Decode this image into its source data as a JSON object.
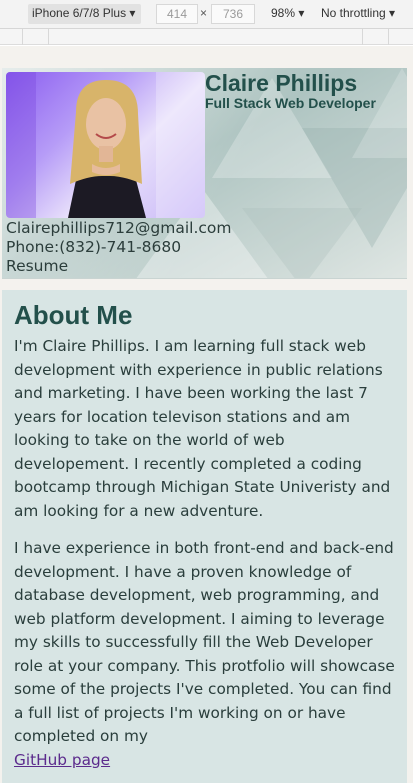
{
  "devtools": {
    "device": "iPhone 6/7/8 Plus ▾",
    "width": "414",
    "times": "×",
    "height": "736",
    "zoom": "98% ▾",
    "throttling": "No throttling ▾"
  },
  "header": {
    "name": "Claire Phillips",
    "role": "Full Stack Web Developer",
    "email": "Clairephillips712@gmail.com",
    "phone": "Phone:(832)-741-8680",
    "resume": "Resume"
  },
  "about": {
    "title": "About Me",
    "paragraph1": "I'm Claire Phillips. I am learning full stack web development with experience in public relations and marketing. I have been working the last 7 years for location televison stations and am looking to take on the world of web developement. I recently completed a coding bootcamp through Michigan State Univeristy and am looking for a new adventure.",
    "paragraph2": "I have experience in both front-end and back-end development. I have a proven knowledge of database development, web programming, and web platform development. I aiming to leverage my skills to successfully fill the Web Developer role at your company. This protfolio will showcase some of the projects I've completed. You can find a full list of projects I'm working on or have completed on my",
    "link": "GitHub page"
  },
  "colors": {
    "accent": "#23504b",
    "link": "#5b2a8c",
    "panel": "#d8e5e4"
  }
}
